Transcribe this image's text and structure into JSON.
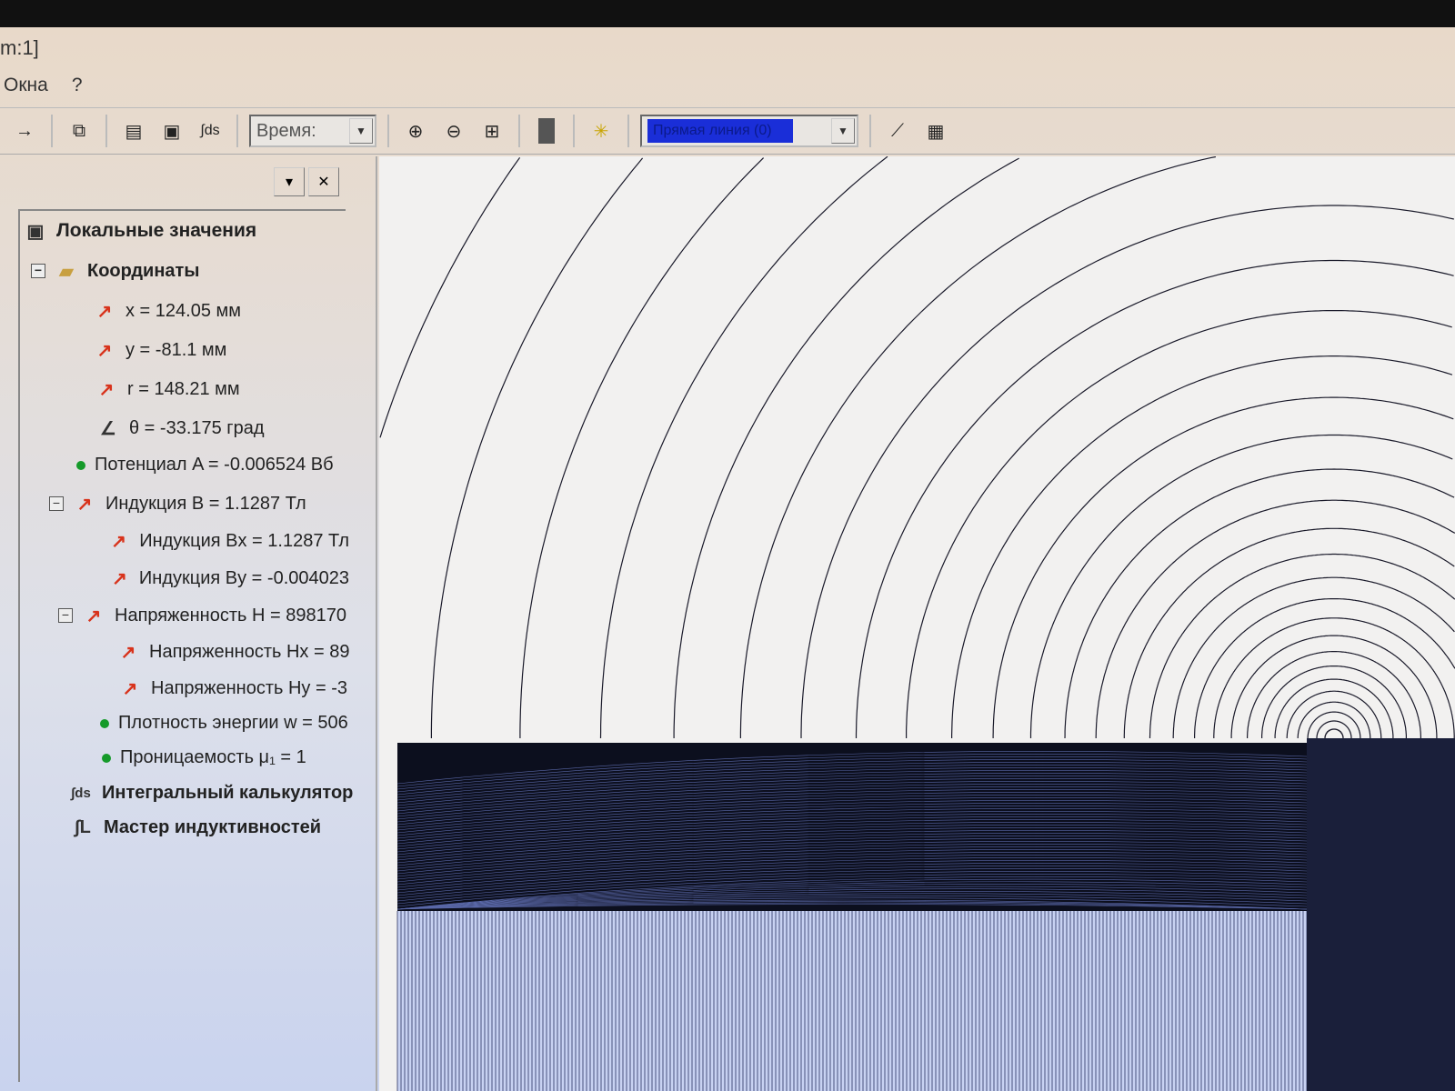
{
  "window": {
    "title": "m:1]"
  },
  "menu": [
    "Окна",
    "?"
  ],
  "toolbar": {
    "time_label": "Время:",
    "line_select": "Прямая линия (0)"
  },
  "tree": {
    "root": "Локальные значения",
    "coords": "Координаты",
    "x": "x = 124.05 мм",
    "y": "y = -81.1 мм",
    "r": "r = 148.21 мм",
    "theta": "θ = -33.175 град",
    "potential": "Потенциал A = -0.006524 Вб",
    "B": "Индукция B = 1.1287 Тл",
    "Bx": "Индукция Bx = 1.1287 Тл",
    "By": "Индукция By = -0.004023",
    "H": "Напряженность H = 898170",
    "Hx": "Напряженность Hx = 89",
    "Hy": "Напряженность Hy = -3",
    "w": "Плотность энергии w = 506",
    "mu": "Проницаемость μ₁ = 1",
    "integral": "Интегральный калькулятор",
    "inductance": "Мастер индуктивностей"
  },
  "colors": {
    "accent": "#1a2ed8",
    "icon_red": "#d8331c",
    "dot_green": "#159a2a"
  }
}
